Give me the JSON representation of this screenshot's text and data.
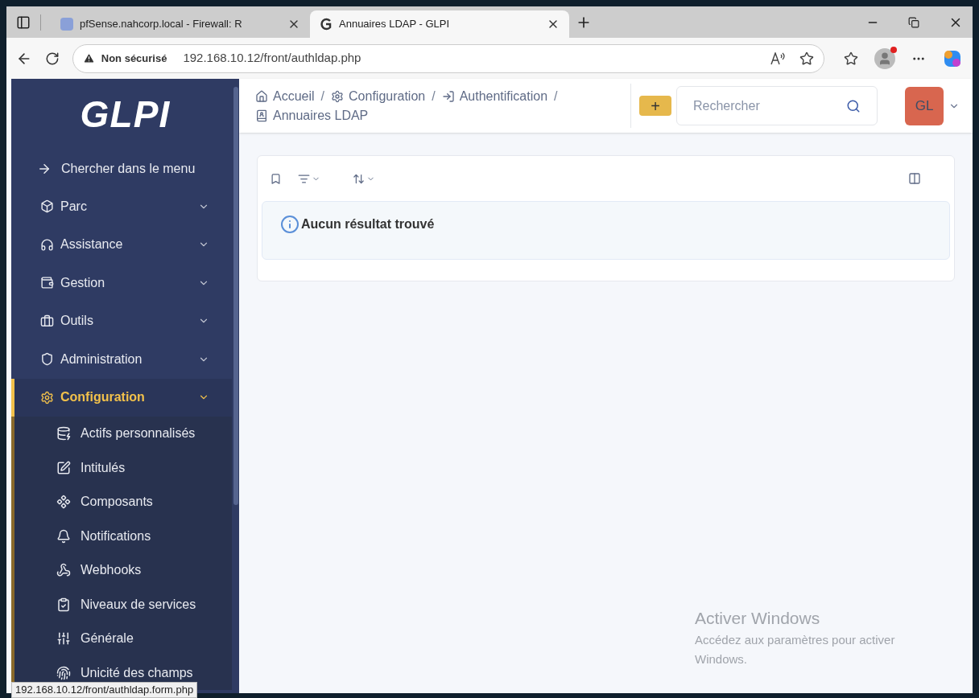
{
  "browser": {
    "tabs": [
      {
        "title": "pfSense.nahcorp.local - Firewall: R",
        "selected": false
      },
      {
        "title": "Annuaires LDAP - GLPI",
        "selected": true
      }
    ],
    "address": {
      "warning": "Non sécurisé",
      "url": "192.168.10.12/front/authldap.php"
    },
    "status_url": "192.168.10.12/front/authldap.form.php"
  },
  "sidebar": {
    "logo": "GLPI",
    "search_item": "Chercher dans le menu",
    "items": [
      {
        "label": "Parc",
        "selected": false,
        "expanded": false
      },
      {
        "label": "Assistance",
        "selected": false,
        "expanded": false
      },
      {
        "label": "Gestion",
        "selected": false,
        "expanded": false
      },
      {
        "label": "Outils",
        "selected": false,
        "expanded": false
      },
      {
        "label": "Administration",
        "selected": false,
        "expanded": false
      },
      {
        "label": "Configuration",
        "selected": true,
        "expanded": true,
        "children": [
          {
            "label": "Actifs personnalisés"
          },
          {
            "label": "Intitulés"
          },
          {
            "label": "Composants"
          },
          {
            "label": "Notifications"
          },
          {
            "label": "Webhooks"
          },
          {
            "label": "Niveaux de services"
          },
          {
            "label": "Générale"
          },
          {
            "label": "Unicité des champs"
          }
        ]
      }
    ]
  },
  "header": {
    "breadcrumb": [
      "Accueil",
      "Configuration",
      "Authentification",
      "Annuaires LDAP"
    ],
    "breadcrumb_separators": [
      "/",
      "/",
      "/"
    ],
    "add_button": "+",
    "search": {
      "placeholder": "Rechercher"
    },
    "avatar": "GL"
  },
  "results": {
    "message": "Aucun résultat trouvé"
  },
  "activation": {
    "title": "Activer Windows",
    "text": "Accédez aux paramètres pour activer Windows."
  }
}
